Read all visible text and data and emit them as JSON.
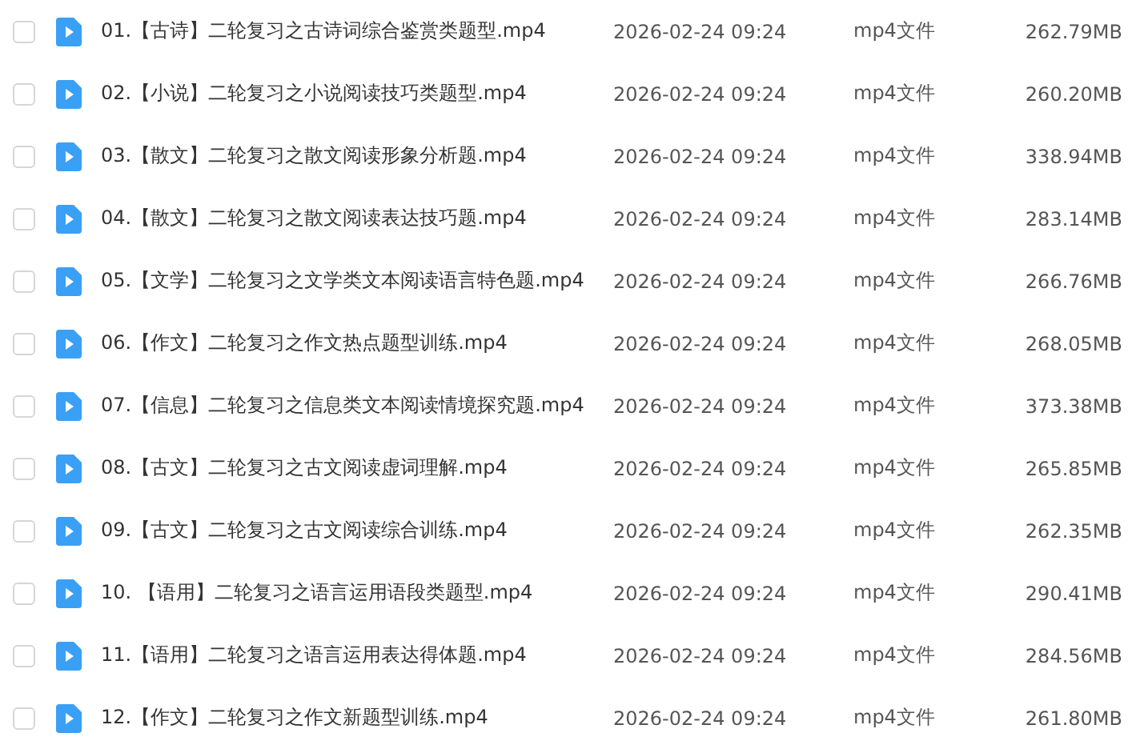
{
  "files": [
    {
      "name": "01.【古诗】二轮复习之古诗词综合鉴赏类题型.mp4",
      "date": "2026-02-24 09:24",
      "type": "mp4文件",
      "size": "262.79MB",
      "checked": false
    },
    {
      "name": "02.【小说】二轮复习之小说阅读技巧类题型.mp4",
      "date": "2026-02-24 09:24",
      "type": "mp4文件",
      "size": "260.20MB",
      "checked": false
    },
    {
      "name": "03.【散文】二轮复习之散文阅读形象分析题.mp4",
      "date": "2026-02-24 09:24",
      "type": "mp4文件",
      "size": "338.94MB",
      "checked": false
    },
    {
      "name": "04.【散文】二轮复习之散文阅读表达技巧题.mp4",
      "date": "2026-02-24 09:24",
      "type": "mp4文件",
      "size": "283.14MB",
      "checked": false
    },
    {
      "name": "05.【文学】二轮复习之文学类文本阅读语言特色题.mp4",
      "date": "2026-02-24 09:24",
      "type": "mp4文件",
      "size": "266.76MB",
      "checked": false
    },
    {
      "name": "06.【作文】二轮复习之作文热点题型训练.mp4",
      "date": "2026-02-24 09:24",
      "type": "mp4文件",
      "size": "268.05MB",
      "checked": false
    },
    {
      "name": "07.【信息】二轮复习之信息类文本阅读情境探究题.mp4",
      "date": "2026-02-24 09:24",
      "type": "mp4文件",
      "size": "373.38MB",
      "checked": false
    },
    {
      "name": "08.【古文】二轮复习之古文阅读虚词理解.mp4",
      "date": "2026-02-24 09:24",
      "type": "mp4文件",
      "size": "265.85MB",
      "checked": false
    },
    {
      "name": "09.【古文】二轮复习之古文阅读综合训练.mp4",
      "date": "2026-02-24 09:24",
      "type": "mp4文件",
      "size": "262.35MB",
      "checked": false
    },
    {
      "name": "10. 【语用】二轮复习之语言运用语段类题型.mp4",
      "date": "2026-02-24 09:24",
      "type": "mp4文件",
      "size": "290.41MB",
      "checked": false
    },
    {
      "name": "11.【语用】二轮复习之语言运用表达得体题.mp4",
      "date": "2026-02-24 09:24",
      "type": "mp4文件",
      "size": "284.56MB",
      "checked": false
    },
    {
      "name": "12.【作文】二轮复习之作文新题型训练.mp4",
      "date": "2026-02-24 09:24",
      "type": "mp4文件",
      "size": "261.80MB",
      "checked": false
    }
  ]
}
